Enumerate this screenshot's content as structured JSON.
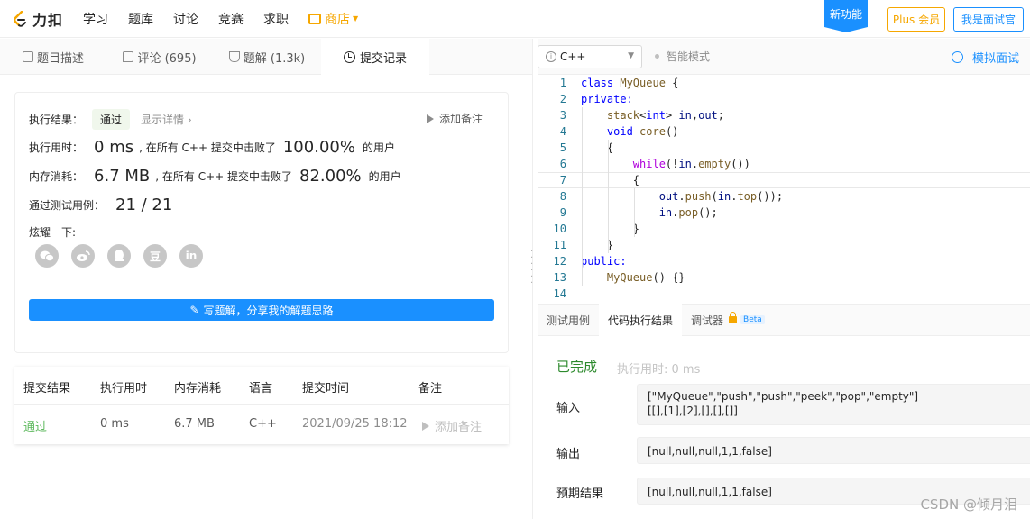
{
  "nav": {
    "logo_text": "力扣",
    "items": [
      "学习",
      "题库",
      "讨论",
      "竞赛",
      "求职"
    ],
    "store": "商店",
    "new_feature": "新功能",
    "plus": "Plus 会员",
    "interviewer": "我是面试官"
  },
  "left_tabs": [
    {
      "label": "题目描述",
      "icon": "document-icon"
    },
    {
      "label": "评论 (695)",
      "icon": "comment-icon"
    },
    {
      "label": "题解 (1.3k)",
      "icon": "flask-icon"
    },
    {
      "label": "提交记录",
      "icon": "clock-icon",
      "active": true
    }
  ],
  "result": {
    "result_label": "执行结果：",
    "status": "通过",
    "detail_link": "显示详情 ›",
    "add_note": "添加备注",
    "time_label": "执行用时：",
    "time_value": "0 ms",
    "time_text": ", 在所有 C++ 提交中击败了",
    "time_pct": "100.00%",
    "time_suffix": "的用户",
    "mem_label": "内存消耗：",
    "mem_value": "6.7 MB",
    "mem_text": ", 在所有 C++ 提交中击败了",
    "mem_pct": "82.00%",
    "mem_suffix": "的用户",
    "tests_label": "通过测试用例：",
    "tests_value": "21 / 21",
    "share_label": "炫耀一下:",
    "share_icons": [
      "wechat-icon",
      "weibo-icon",
      "qq-icon",
      "douban-icon",
      "linkedin-icon"
    ],
    "share_glyphs": [
      "",
      "",
      "",
      "豆",
      "in"
    ],
    "write_button": "写题解，分享我的解题思路"
  },
  "submissions": {
    "headers": [
      "提交结果",
      "执行用时",
      "内存消耗",
      "语言",
      "提交时间",
      "备注"
    ],
    "row": {
      "result": "通过",
      "time": "0 ms",
      "memory": "6.7 MB",
      "lang": "C++",
      "submitted": "2021/09/25 18:12",
      "note": "添加备注"
    }
  },
  "editor": {
    "language": "C++",
    "smart_mode": "智能模式",
    "mock_interview": "模拟面试",
    "lines": [
      "class MyQueue {",
      "private:",
      "    stack<int> in,out;",
      "    void core()",
      "    {",
      "        while(!in.empty())",
      "        {",
      "            out.push(in.top());",
      "            in.pop();",
      "        }",
      "    }",
      "public:",
      "    MyQueue() {}",
      ""
    ]
  },
  "console": {
    "tabs": [
      "测试用例",
      "代码执行结果",
      "调试器"
    ],
    "beta": "Beta",
    "status": "已完成",
    "exec_time": "执行用时: 0 ms",
    "input_label": "输入",
    "input_line1": "[\"MyQueue\",\"push\",\"push\",\"peek\",\"pop\",\"empty\"]",
    "input_line2": "[[],[1],[2],[],[],[]]",
    "output_label": "输出",
    "output_value": "[null,null,null,1,1,false]",
    "expected_label": "预期结果",
    "expected_value": "[null,null,null,1,1,false]"
  },
  "watermark": "CSDN @倾月泪",
  "colors": {
    "accent": "#1a90ff",
    "gold": "#f6a700",
    "pass": "#5cb85c"
  }
}
